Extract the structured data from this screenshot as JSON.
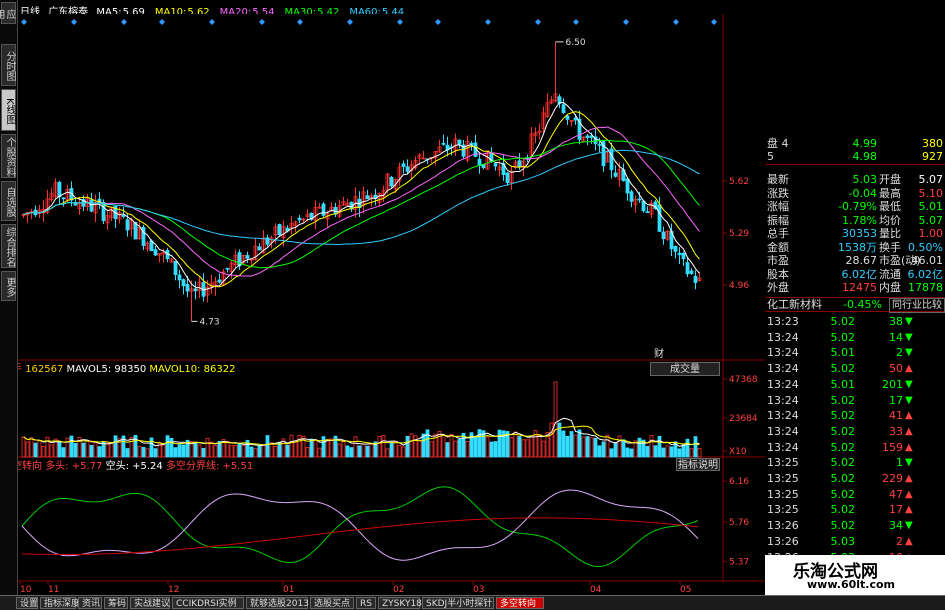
{
  "header": {
    "period": "日线",
    "stock_name": "广东榕泰",
    "ma": [
      {
        "label": "MA5:",
        "value": "5.69",
        "color": "#ffffff"
      },
      {
        "label": "MA10:",
        "value": "5.62",
        "color": "#ffff00"
      },
      {
        "label": "MA20:",
        "value": "5.54",
        "color": "#ff66ff"
      },
      {
        "label": "MA30:",
        "value": "5.42",
        "color": "#00ff00"
      },
      {
        "label": "MA60:",
        "value": "5.44",
        "color": "#33ccff"
      }
    ]
  },
  "left_toolbar": [
    "应用",
    "分时图",
    "K线图",
    "个股资料",
    "自选股",
    "综合排名",
    "更多"
  ],
  "price_chart": {
    "high_label": "6.50",
    "low_label": "4.73",
    "y_ticks": [
      "5.62",
      "5.29",
      "4.96"
    ],
    "marker": "财"
  },
  "volume_panel": {
    "title": "总手",
    "total": "162567",
    "mavol5_label": "MAVOL5:",
    "mavol5": "98350",
    "mavol10_label": "MAVOL10:",
    "mavol10": "86322",
    "y_ticks": [
      "47368",
      "23684",
      "X10"
    ],
    "selector": "成交量"
  },
  "indicator_panel": {
    "name": "多空转向",
    "long_label": "多头:",
    "long_value": "+5.77",
    "short_label": "空头:",
    "short_value": "+5.24",
    "divider_label": "多空分界线:",
    "divider_value": "+5.51",
    "y_ticks": [
      "6.16",
      "5.76",
      "5.37"
    ],
    "help_button": "指标说明"
  },
  "x_axis": [
    "10",
    "11",
    "12",
    "01",
    "02",
    "03",
    "04",
    "05"
  ],
  "quote_panel": {
    "bid_rows": [
      {
        "label": "盘 4",
        "price": "4.99",
        "vol": "380"
      },
      {
        "label": "5",
        "price": "4.98",
        "vol": "927"
      }
    ],
    "rows": [
      {
        "l1": "最新",
        "v1": "5.03",
        "l2": "开盘",
        "v2": "5.07",
        "c1": "#00ff00",
        "c2": "#ffffff"
      },
      {
        "l1": "涨跌",
        "v1": "-0.04",
        "l2": "最高",
        "v2": "5.10",
        "c1": "#00ff00",
        "c2": "#ff4040"
      },
      {
        "l1": "涨幅",
        "v1": "-0.79%",
        "l2": "最低",
        "v2": "5.01",
        "c1": "#00ff00",
        "c2": "#00ff00"
      },
      {
        "l1": "振幅",
        "v1": "1.78%",
        "l2": "均价",
        "v2": "5.07",
        "c1": "#00ff00",
        "c2": "#00ff00"
      },
      {
        "l1": "总手",
        "v1": "30353",
        "l2": "量比",
        "v2": "1.00",
        "c1": "#33ccff",
        "c2": "#ff4040"
      },
      {
        "l1": "金额",
        "v1": "1538万",
        "l2": "换手",
        "v2": "0.50%",
        "c1": "#33ccff",
        "c2": "#33ccff"
      },
      {
        "l1": "市盈",
        "v1": "28.67",
        "l2": "市盈(动)",
        "v2": "46.01",
        "c1": "#dddddd",
        "c2": "#dddddd"
      },
      {
        "l1": "股本",
        "v1": "6.02亿",
        "l2": "流通",
        "v2": "6.02亿",
        "c1": "#33ccff",
        "c2": "#33ccff"
      },
      {
        "l1": "外盘",
        "v1": "12475",
        "l2": "内盘",
        "v2": "17878",
        "c1": "#ff4040",
        "c2": "#00ff00"
      }
    ],
    "sector": "化工新材料",
    "sector_change": "-0.45%",
    "compare": "同行业比较",
    "ticks": [
      {
        "time": "13:23",
        "price": "5.02",
        "vol": "38",
        "dir": "down"
      },
      {
        "time": "13:24",
        "price": "5.02",
        "vol": "14",
        "dir": "down"
      },
      {
        "time": "13:24",
        "price": "5.01",
        "vol": "2",
        "dir": "down"
      },
      {
        "time": "13:24",
        "price": "5.02",
        "vol": "50",
        "dir": "up"
      },
      {
        "time": "13:24",
        "price": "5.01",
        "vol": "201",
        "dir": "down"
      },
      {
        "time": "13:24",
        "price": "5.02",
        "vol": "17",
        "dir": "down"
      },
      {
        "time": "13:24",
        "price": "5.02",
        "vol": "41",
        "dir": "up"
      },
      {
        "time": "13:24",
        "price": "5.02",
        "vol": "33",
        "dir": "up"
      },
      {
        "time": "13:24",
        "price": "5.02",
        "vol": "159",
        "dir": "up"
      },
      {
        "time": "13:25",
        "price": "5.02",
        "vol": "1",
        "dir": "down"
      },
      {
        "time": "13:25",
        "price": "5.02",
        "vol": "229",
        "dir": "up"
      },
      {
        "time": "13:25",
        "price": "5.02",
        "vol": "47",
        "dir": "up"
      },
      {
        "time": "13:25",
        "price": "5.02",
        "vol": "17",
        "dir": "up"
      },
      {
        "time": "13:26",
        "price": "5.02",
        "vol": "34",
        "dir": "down"
      },
      {
        "time": "13:26",
        "price": "5.03",
        "vol": "2",
        "dir": "up"
      },
      {
        "time": "13:26",
        "price": "5.03",
        "vol": "10",
        "dir": "up"
      }
    ]
  },
  "bottom_tabs": [
    "设置",
    "指标深度",
    "资讯",
    "筹码",
    "实战建议",
    "CCIKDRSI实例",
    "就够选股2013",
    "选股买点",
    "RS",
    "ZYSKY18",
    "SKDJ半小时探针",
    "多空转向"
  ],
  "active_tab": "多空转向",
  "watermark": {
    "cn": "乐淘公式网",
    "url": "www.60lt.com"
  }
}
